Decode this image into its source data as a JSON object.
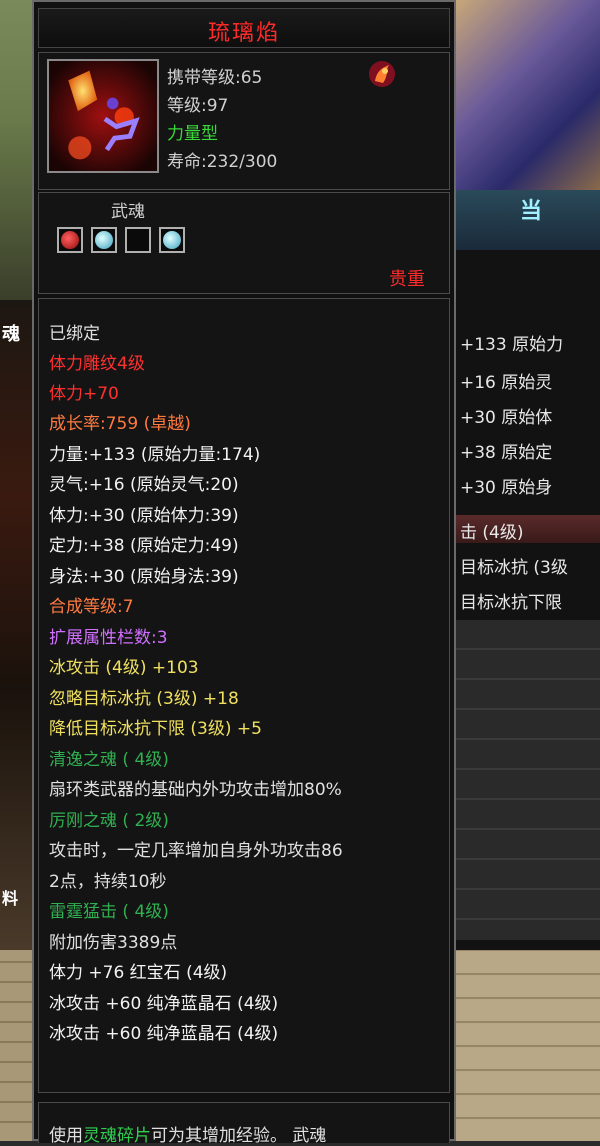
{
  "item": {
    "title": "琉璃焰",
    "stats": {
      "carry_level": "携带等级:65",
      "level": "等级:97",
      "type": "力量型",
      "lifespan": "寿命:232/300"
    },
    "wuhun": {
      "label": "武魂",
      "slots": [
        {
          "icon": "red-gem-icon",
          "color": "#c01818"
        },
        {
          "icon": "ice-gem-icon",
          "color": "#60c0d8"
        },
        {
          "icon": "empty-slot",
          "color": ""
        },
        {
          "icon": "ice-gem-icon",
          "color": "#60c0d8"
        }
      ],
      "precious_label": "贵重"
    },
    "attributes": [
      {
        "text": "已绑定",
        "color": "white"
      },
      {
        "text": "体力雕纹4级",
        "color": "red"
      },
      {
        "text": "体力+70",
        "color": "red"
      },
      {
        "text": "成长率:759 (卓越)",
        "color": "orange"
      },
      {
        "text": "力量:+133  (原始力量:174)",
        "color": "bright"
      },
      {
        "text": "灵气:+16  (原始灵气:20)",
        "color": "bright"
      },
      {
        "text": "体力:+30  (原始体力:39)",
        "color": "bright"
      },
      {
        "text": "定力:+38  (原始定力:49)",
        "color": "bright"
      },
      {
        "text": "身法:+30  (原始身法:39)",
        "color": "bright"
      },
      {
        "text": "合成等级:7",
        "color": "orange"
      },
      {
        "text": "扩展属性栏数:3",
        "color": "purple"
      },
      {
        "text": "冰攻击 (4级) +103",
        "color": "yellow"
      },
      {
        "text": "忽略目标冰抗 (3级) +18",
        "color": "yellow"
      },
      {
        "text": "降低目标冰抗下限 (3级) +5",
        "color": "yellow"
      },
      {
        "text": "清逸之魂 ( 4级)",
        "color": "green"
      },
      {
        "text": "扇环类武器的基础内外功攻击增加80%",
        "color": "white"
      },
      {
        "text": "厉刚之魂 ( 2级)",
        "color": "green"
      },
      {
        "text": "攻击时，一定几率增加自身外功攻击86",
        "color": "white"
      },
      {
        "text": "2点，持续10秒",
        "color": "white"
      },
      {
        "text": "雷霆猛击 ( 4级)",
        "color": "green"
      },
      {
        "text": "附加伤害3389点",
        "color": "white"
      },
      {
        "text": "体力 +76  红宝石 (4级)",
        "color": "bright"
      },
      {
        "text": "冰攻击  +60  纯净蓝晶石 (4级)",
        "color": "bright"
      },
      {
        "text": "冰攻击  +60  纯净蓝晶石 (4级)",
        "color": "bright"
      }
    ],
    "footer": {
      "prefix": "使用",
      "highlight": "灵魂碎片",
      "suffix": "可为其增加经验。 武魂"
    }
  },
  "background": {
    "right_rows": [
      {
        "text": "+133 原始力",
        "color": "white"
      },
      {
        "text": "+16  原始灵",
        "color": "white"
      },
      {
        "text": "+30  原始体",
        "color": "white"
      },
      {
        "text": "+38  原始定",
        "color": "white"
      },
      {
        "text": "+30  原始身",
        "color": "white"
      }
    ],
    "right_rows_2": [
      {
        "text": "击 (4级)",
        "color": "white"
      },
      {
        "text": "目标冰抗 (3级",
        "color": "white"
      },
      {
        "text": "目标冰抗下限",
        "color": "white"
      }
    ],
    "right_top_text": "当",
    "left_label_1": "魂",
    "left_label_2": "料"
  }
}
